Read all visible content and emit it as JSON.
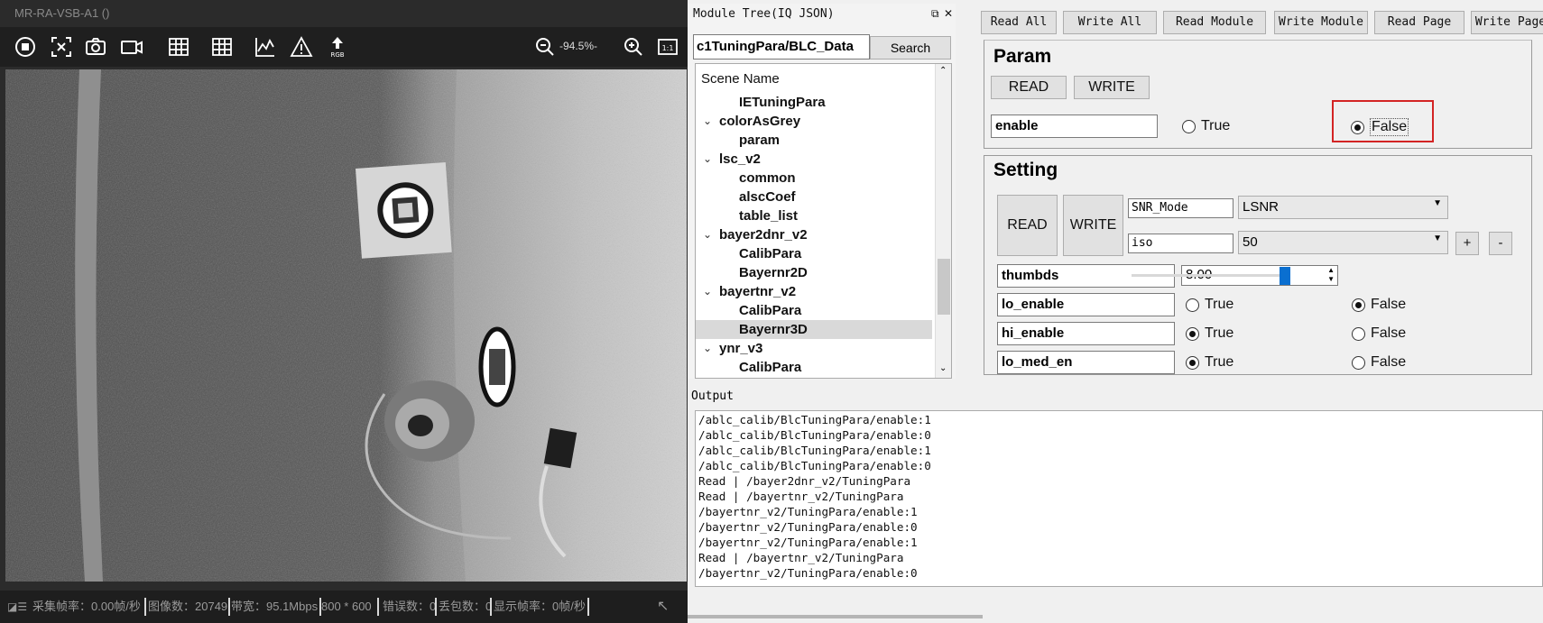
{
  "viewer": {
    "title": "MR-RA-VSB-A1 ()",
    "zoom": "-94.5%-",
    "rgb_label": "RGB",
    "status": {
      "capture_fps": "采集帧率：0.00帧/秒",
      "image_count": "图像数：20749",
      "bandwidth": "带宽：95.1Mbps",
      "resolution": "800 * 600",
      "error_count": "错误数：0",
      "lost_packets": "丢包数：0",
      "display_fps": "显示帧率：0帧/秒"
    },
    "toolbar_icons": [
      "stop-icon",
      "fit-screen-icon",
      "camera-icon",
      "video-icon",
      "grid-icon",
      "grid-icon",
      "line-chart-icon",
      "warning-icon",
      "rgb-upload-icon",
      "zoom-out-icon",
      "zoom-in-icon",
      "actual-size-icon"
    ]
  },
  "module_tree": {
    "title": "Module Tree(IQ JSON)",
    "path_value": "c1TuningPara/BLC_Data",
    "search_label": "Search",
    "header": "Scene Name",
    "items": [
      {
        "label": "IETuningPara",
        "level": 1,
        "expanded": false,
        "selected": false
      },
      {
        "label": "colorAsGrey",
        "level": 0,
        "expanded": true,
        "selected": false
      },
      {
        "label": "param",
        "level": 1,
        "expanded": false,
        "selected": false
      },
      {
        "label": "lsc_v2",
        "level": 0,
        "expanded": true,
        "selected": false
      },
      {
        "label": "common",
        "level": 1,
        "expanded": false,
        "selected": false
      },
      {
        "label": "alscCoef",
        "level": 1,
        "expanded": false,
        "selected": false
      },
      {
        "label": "table_list",
        "level": 1,
        "expanded": false,
        "selected": false
      },
      {
        "label": "bayer2dnr_v2",
        "level": 0,
        "expanded": true,
        "selected": false
      },
      {
        "label": "CalibPara",
        "level": 1,
        "expanded": false,
        "selected": false
      },
      {
        "label": "Bayernr2D",
        "level": 1,
        "expanded": false,
        "selected": false
      },
      {
        "label": "bayertnr_v2",
        "level": 0,
        "expanded": true,
        "selected": false
      },
      {
        "label": "CalibPara",
        "level": 1,
        "expanded": false,
        "selected": false
      },
      {
        "label": "Bayernr3D",
        "level": 1,
        "expanded": false,
        "selected": true
      },
      {
        "label": "ynr_v3",
        "level": 0,
        "expanded": true,
        "selected": false
      },
      {
        "label": "CalibPara",
        "level": 1,
        "expanded": false,
        "selected": false
      }
    ]
  },
  "top_buttons": [
    "Read All",
    "Write All",
    "Read Module",
    "Write Module",
    "Read Page",
    "Write Page"
  ],
  "param": {
    "title": "Param",
    "read_label": "READ",
    "write_label": "WRITE",
    "field": "enable",
    "true_label": "True",
    "false_label": "False",
    "value": false
  },
  "setting": {
    "title": "Setting",
    "read_label": "READ",
    "write_label": "WRITE",
    "snr_mode_label": "SNR_Mode",
    "snr_mode_value": "LSNR",
    "iso_label": "iso",
    "iso_value": "50",
    "plus_label": "+",
    "minus_label": "-",
    "thumbds_label": "thumbds",
    "thumbds_value": "8.00",
    "thumbds_slider_fraction": 1.0,
    "rows": [
      {
        "name": "lo_enable",
        "value": false,
        "true_label": "True",
        "false_label": "False"
      },
      {
        "name": "hi_enable",
        "value": true,
        "true_label": "True",
        "false_label": "False"
      },
      {
        "name": "lo_med_en",
        "value": true,
        "true_label": "True",
        "false_label": "False"
      }
    ]
  },
  "output": {
    "label": "Output",
    "lines": [
      "/ablc_calib/BlcTuningPara/enable:1",
      "/ablc_calib/BlcTuningPara/enable:0",
      "/ablc_calib/BlcTuningPara/enable:1",
      "/ablc_calib/BlcTuningPara/enable:0",
      "Read | /bayer2dnr_v2/TuningPara",
      "Read | /bayertnr_v2/TuningPara",
      "/bayertnr_v2/TuningPara/enable:1",
      "/bayertnr_v2/TuningPara/enable:0",
      "/bayertnr_v2/TuningPara/enable:1",
      "Read | /bayertnr_v2/TuningPara",
      "/bayertnr_v2/TuningPara/enable:0"
    ]
  }
}
